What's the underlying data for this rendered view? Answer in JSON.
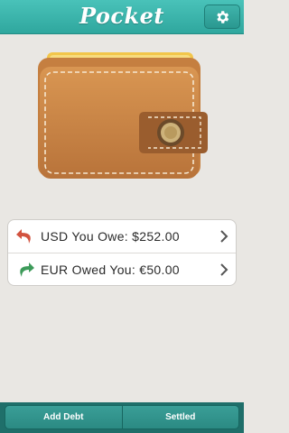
{
  "header": {
    "title": "Pocket",
    "settings_icon": "gear-icon"
  },
  "summary": {
    "items": [
      {
        "label": "USD You Owe: $252.00",
        "icon": "undo-arrow-icon",
        "color": "#d2533f"
      },
      {
        "label": "EUR Owed You: €50.00",
        "icon": "forward-arrow-icon",
        "color": "#3d9b5a"
      }
    ]
  },
  "tabbar": {
    "add_debt": "Add Debt",
    "settled": "Settled"
  },
  "colors": {
    "accent": "#2fa79e",
    "tabbar": "#1f6f6a"
  }
}
